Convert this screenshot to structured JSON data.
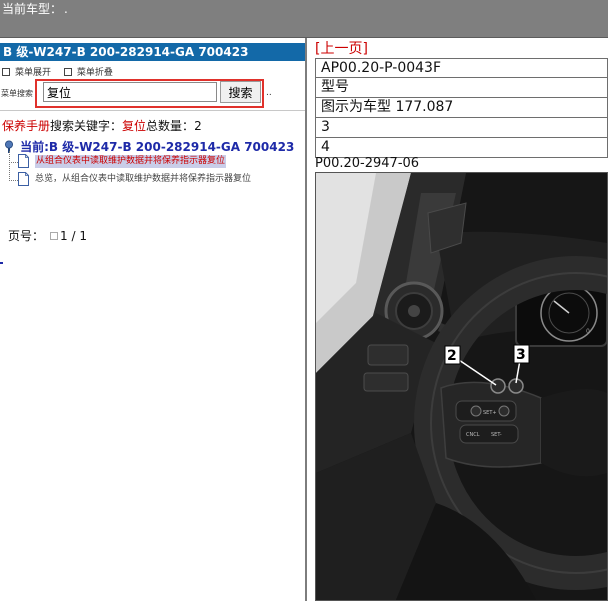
{
  "topbar": {
    "title": "当前车型：",
    "suffix": "."
  },
  "left": {
    "header": "B 级-W247-B 200-282914-GA 700423",
    "menu_ops": [
      "菜单展开",
      "菜单折叠"
    ],
    "search": {
      "label": "菜单搜索",
      "value": "复位",
      "button": "搜索",
      "trailing": ".."
    },
    "keyword_line": {
      "manual": "保养手册",
      "kw_label": "搜索关键字：",
      "keyword": "复位",
      "count_label": "总数量：",
      "count": "2"
    },
    "tree": {
      "root": "当前:B 级-W247-B 200-282914-GA 700423",
      "items": [
        "从组合仪表中读取维护数据并将保养指示器复位",
        "总览，从组合仪表中读取维护数据并将保养指示器复位"
      ]
    },
    "pager": {
      "label": "页号：",
      "value": "1 / 1"
    }
  },
  "right": {
    "prev": "[上一页]",
    "rows": [
      "AP00.20-P-0043F",
      "型号",
      "图示为车型 177.087",
      "3",
      "4"
    ],
    "figure_code": "P00.20-2947-06",
    "callouts": [
      "2",
      "3"
    ]
  },
  "colors": {
    "topbar": "#7f7f7f",
    "header_bg": "#1369a8",
    "accent_red": "#cc0000",
    "tree_blue": "#1e2aa8",
    "highlight": "#c9cde8",
    "search_frame": "#e0312b"
  }
}
